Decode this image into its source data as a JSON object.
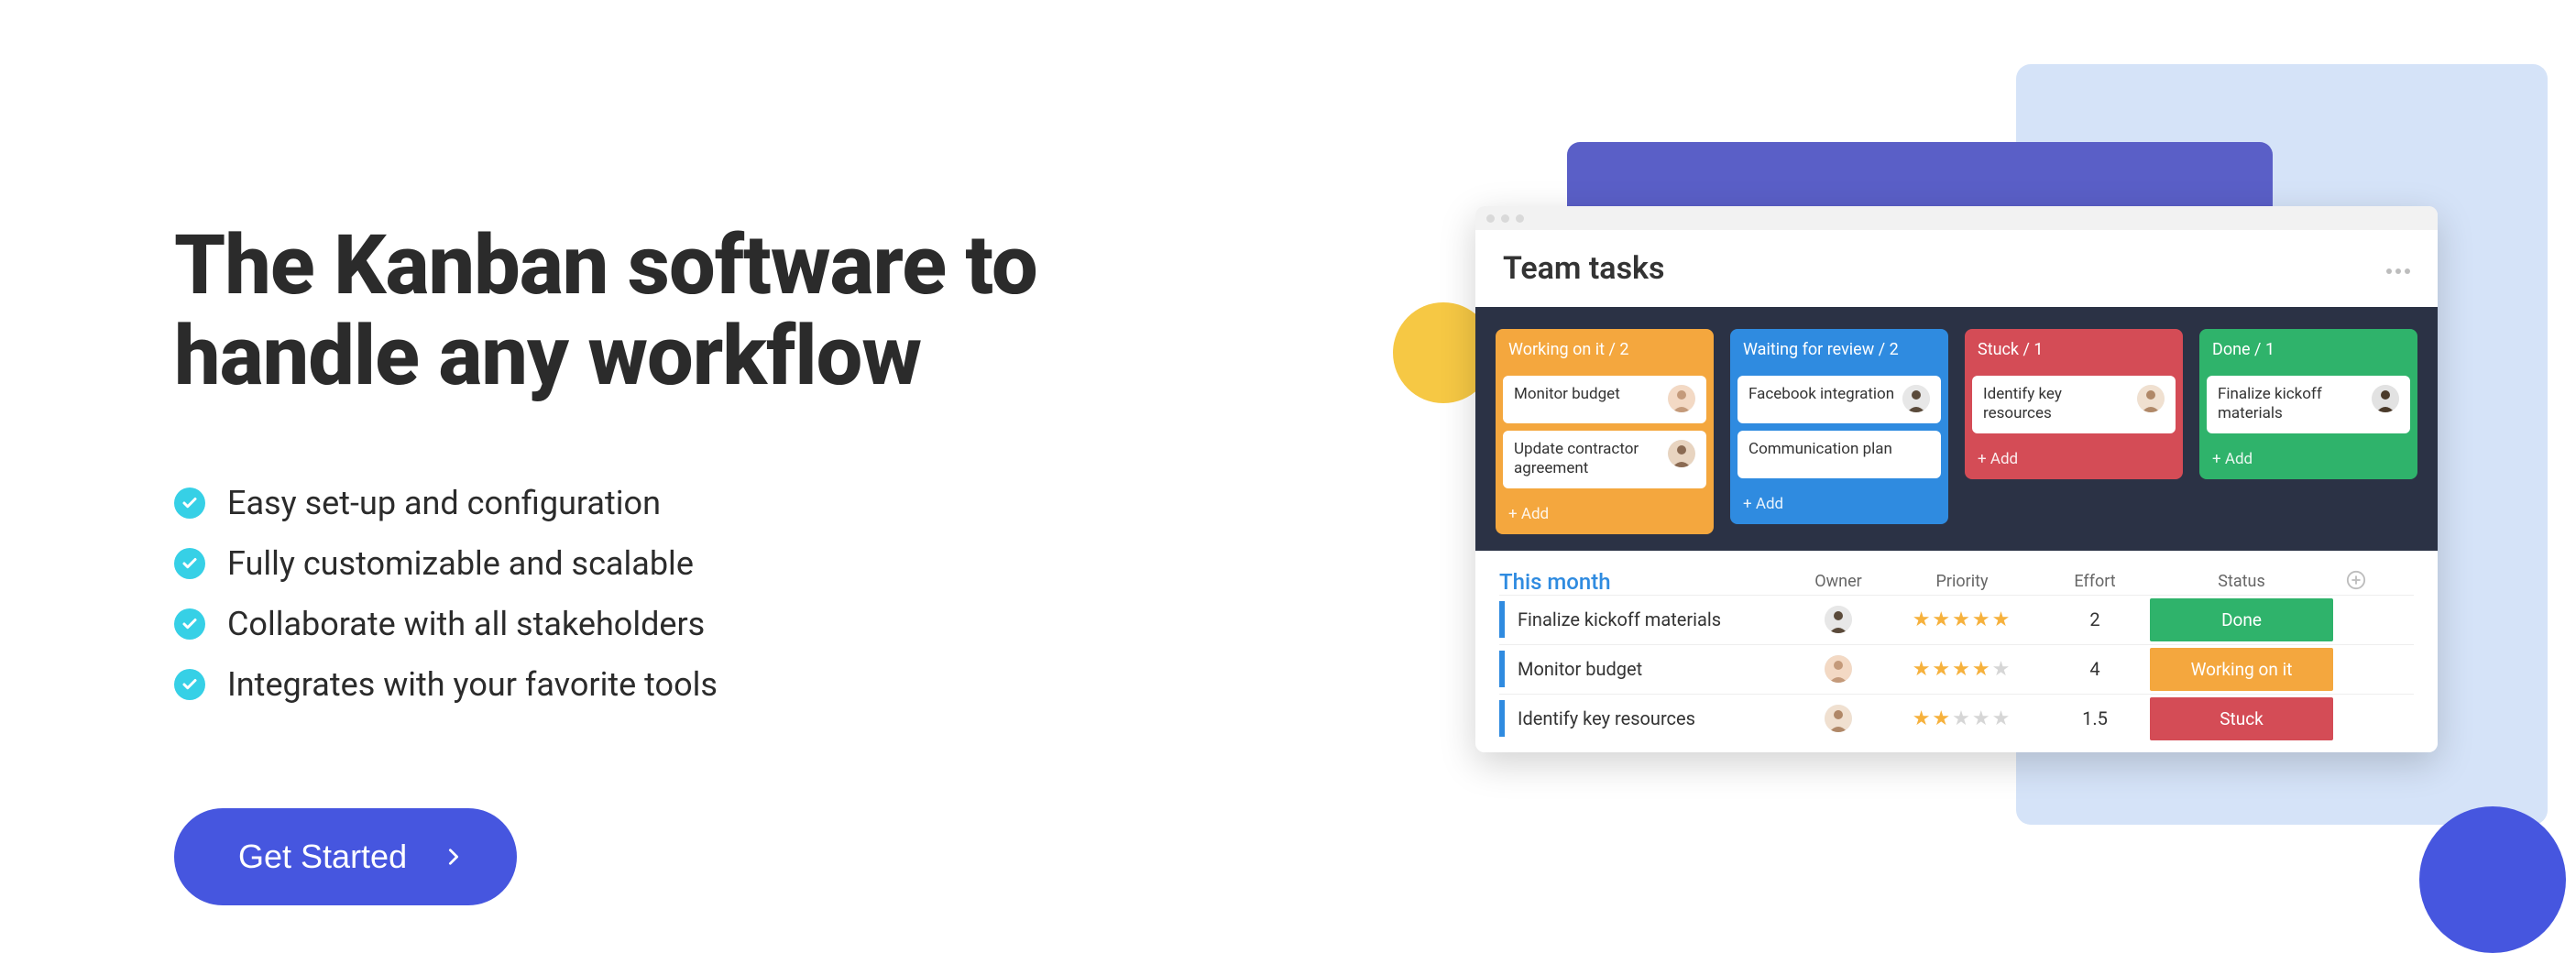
{
  "colors": {
    "accent": "#4656df",
    "check": "#36d0e6",
    "board_bg": "#2b3245",
    "col_working": "#f4a73e",
    "col_waiting": "#2f8be0",
    "col_stuck": "#d44c56",
    "col_done": "#2fb36b",
    "bg_blue": "#d5e3f8",
    "bg_purple": "#5a5fc7",
    "circle_yellow": "#f6c844"
  },
  "hero": {
    "headline": "The Kanban software to handle any workflow",
    "features": [
      "Easy set-up and configuration",
      "Fully customizable and scalable",
      "Collaborate with all stakeholders",
      "Integrates with your favorite tools"
    ],
    "cta_label": "Get Started"
  },
  "app": {
    "title": "Team tasks",
    "more_icon": "more-horizontal-icon",
    "board": {
      "columns": [
        {
          "name": "Working on it",
          "count": 2,
          "color": "orange",
          "cards": [
            {
              "title": "Monitor budget",
              "avatar": "person-a"
            },
            {
              "title": "Update contractor agreement",
              "avatar": "person-b"
            }
          ],
          "add_label": "+ Add"
        },
        {
          "name": "Waiting for review",
          "count": 2,
          "color": "blue",
          "cards": [
            {
              "title": "Facebook integration",
              "avatar": "person-c"
            },
            {
              "title": "Communication plan",
              "avatar": ""
            }
          ],
          "add_label": "+ Add"
        },
        {
          "name": "Stuck",
          "count": 1,
          "color": "red",
          "cards": [
            {
              "title": "Identify key resources",
              "avatar": "person-d"
            }
          ],
          "add_label": "+ Add"
        },
        {
          "name": "Done",
          "count": 1,
          "color": "green",
          "cards": [
            {
              "title": "Finalize kickoff materials",
              "avatar": "person-e"
            }
          ],
          "add_label": "+ Add"
        }
      ]
    },
    "table": {
      "period_label": "This month",
      "headers": {
        "owner": "Owner",
        "priority": "Priority",
        "effort": "Effort",
        "status": "Status"
      },
      "add_icon": "plus-circle-icon",
      "rows": [
        {
          "name": "Finalize kickoff materials",
          "owner": "person-c",
          "priority": 5,
          "effort": "2",
          "status": "Done",
          "status_class": "st-done"
        },
        {
          "name": "Monitor budget",
          "owner": "person-a",
          "priority": 4,
          "effort": "4",
          "status": "Working on it",
          "status_class": "st-work"
        },
        {
          "name": "Identify key resources",
          "owner": "person-d",
          "priority": 2,
          "effort": "1.5",
          "status": "Stuck",
          "status_class": "st-stuck"
        }
      ]
    }
  }
}
